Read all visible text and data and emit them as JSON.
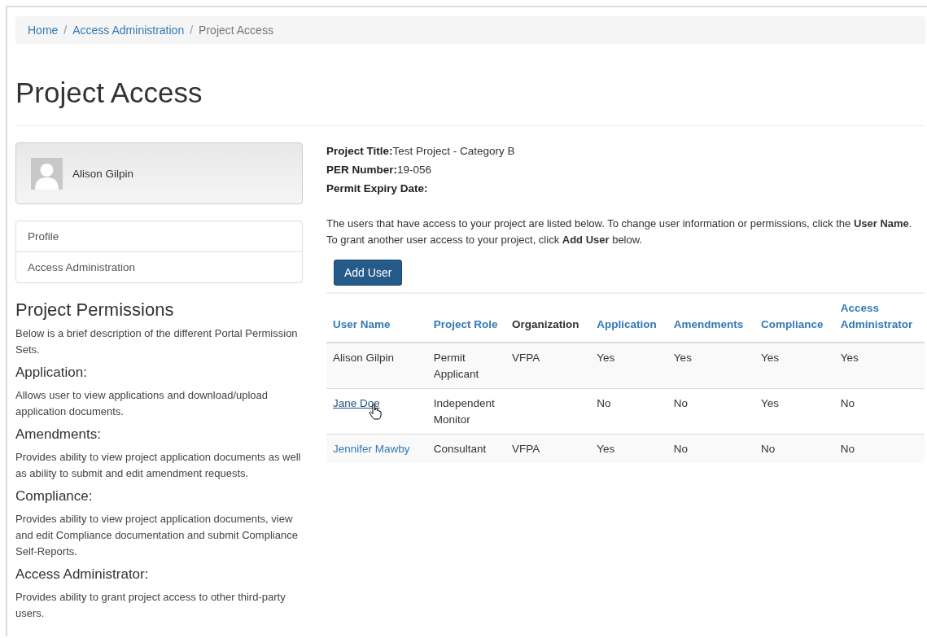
{
  "breadcrumb": [
    {
      "label": "Home",
      "link": true
    },
    {
      "label": "Access Administration",
      "link": true
    },
    {
      "label": "Project Access",
      "link": false
    }
  ],
  "separator": "/",
  "title": "Project Access",
  "profile": {
    "name": "Alison Gilpin"
  },
  "nav": [
    {
      "label": "Profile"
    },
    {
      "label": "Access Administration"
    }
  ],
  "permissions": {
    "heading": "Project Permissions",
    "intro": "Below is a brief description of the different Portal Permission Sets.",
    "sets": [
      {
        "name": "Application:",
        "text": "Allows user to view applications and download/upload application documents."
      },
      {
        "name": "Amendments:",
        "text": "Provides ability to view project application documents as well as ability to submit and edit amendment requests."
      },
      {
        "name": "Compliance:",
        "text": "Provides ability to view project application documents, view and edit Compliance documentation and submit Compliance Self-Reports."
      },
      {
        "name": "Access Administrator:",
        "text": "Provides ability to grant project access to other third-party users."
      }
    ]
  },
  "details": [
    {
      "label": "Project Title:",
      "value": "Test Project - Category B"
    },
    {
      "label": "PER Number:",
      "value": "19-056"
    },
    {
      "label": "Permit Expiry Date:"
    }
  ],
  "instructions": "The users that have access to your project are listed below. To change user information or permissions, click the **User Name**. To grant another user access to your project, click **Add User** below.",
  "add_button": "Add User",
  "table": {
    "columns": [
      {
        "label": "User Name",
        "sortable": true
      },
      {
        "label": "Project Role",
        "sortable": true
      },
      {
        "label": "Organization",
        "sortable": false
      },
      {
        "label": "Application",
        "sortable": true
      },
      {
        "label": "Amendments",
        "sortable": true
      },
      {
        "label": "Compliance",
        "sortable": true
      },
      {
        "label": "Access Administrator",
        "sortable": true
      }
    ],
    "rows": [
      {
        "cells": [
          "Alison Gilpin",
          "Permit Applicant",
          "VFPA",
          "Yes",
          "Yes",
          "Yes",
          "Yes"
        ],
        "link": false,
        "hovered": false
      },
      {
        "cells": [
          "Jane Doe",
          "Independent Monitor",
          "",
          "No",
          "No",
          "Yes",
          "No"
        ],
        "link": true,
        "hovered": true
      },
      {
        "cells": [
          "Jennifer Mawby",
          "Consultant",
          "VFPA",
          "Yes",
          "No",
          "No",
          "No"
        ],
        "link": true,
        "hovered": false
      }
    ]
  }
}
